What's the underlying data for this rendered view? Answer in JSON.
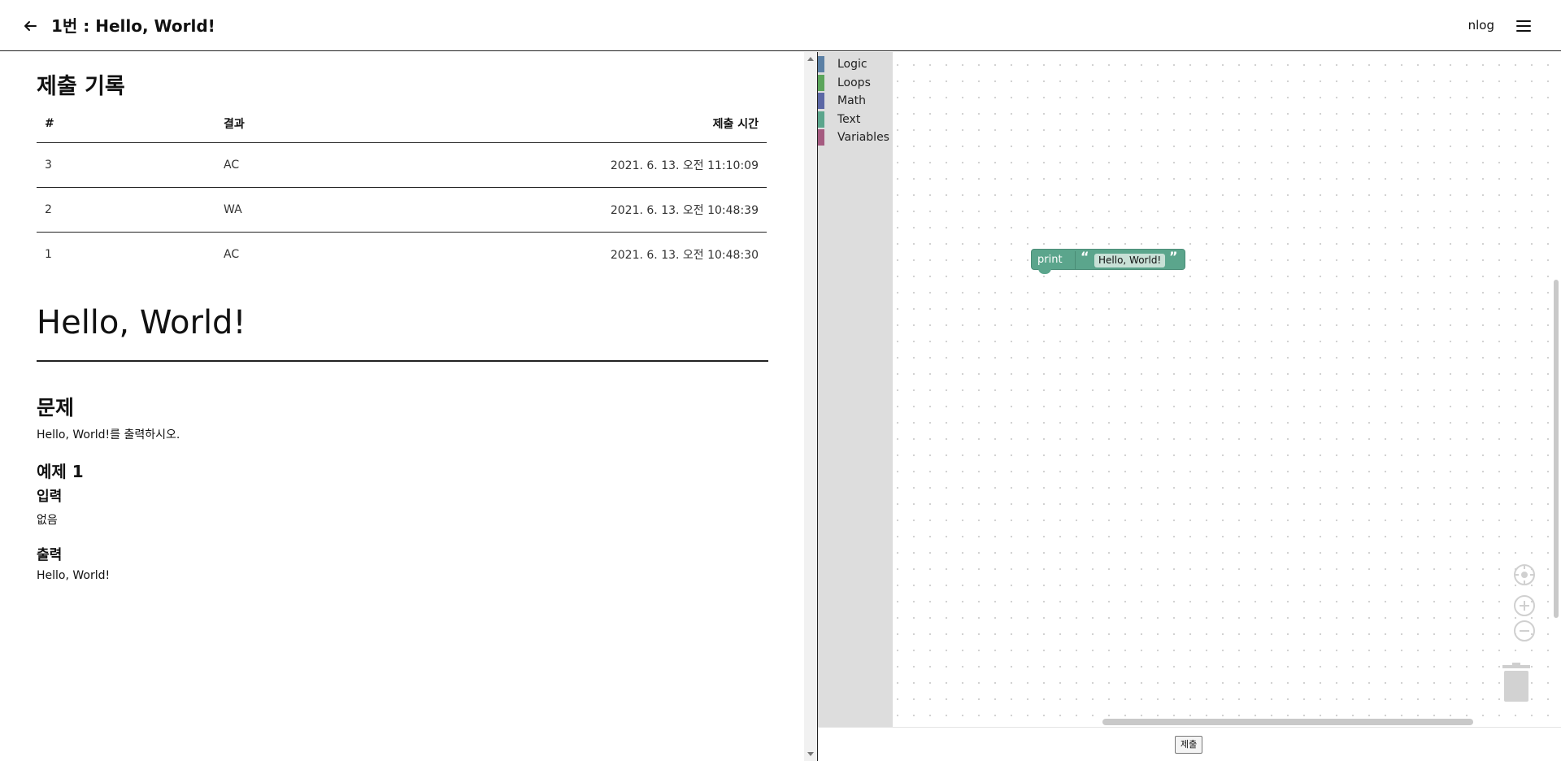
{
  "header": {
    "title": "1번 : Hello, World!",
    "user": "nlog"
  },
  "submissions": {
    "title": "제출 기록",
    "columns": [
      "#",
      "결과",
      "제출 시간"
    ],
    "rows": [
      {
        "id": "3",
        "result": "AC",
        "time": "2021. 6. 13. 오전 11:10:09"
      },
      {
        "id": "2",
        "result": "WA",
        "time": "2021. 6. 13. 오전 10:48:39"
      },
      {
        "id": "1",
        "result": "AC",
        "time": "2021. 6. 13. 오전 10:48:30"
      }
    ]
  },
  "problem": {
    "title": "Hello, World!",
    "section_label": "문제",
    "description": "Hello, World!를 출력하시오.",
    "example_label": "예제 1",
    "input_label": "입력",
    "input_value": "없음",
    "output_label": "출력",
    "output_value": "Hello, World!"
  },
  "toolbox": {
    "categories": [
      {
        "label": "Logic",
        "color": "#5b80a5"
      },
      {
        "label": "Loops",
        "color": "#5ba55b"
      },
      {
        "label": "Math",
        "color": "#5b67a5"
      },
      {
        "label": "Text",
        "color": "#5ba58c"
      },
      {
        "label": "Variables",
        "color": "#a55b80"
      }
    ]
  },
  "workspace": {
    "block_keyword": "print",
    "block_text": "Hello, World!",
    "open_quote": "“",
    "close_quote": "”"
  },
  "footer": {
    "submit_label": "제출"
  }
}
